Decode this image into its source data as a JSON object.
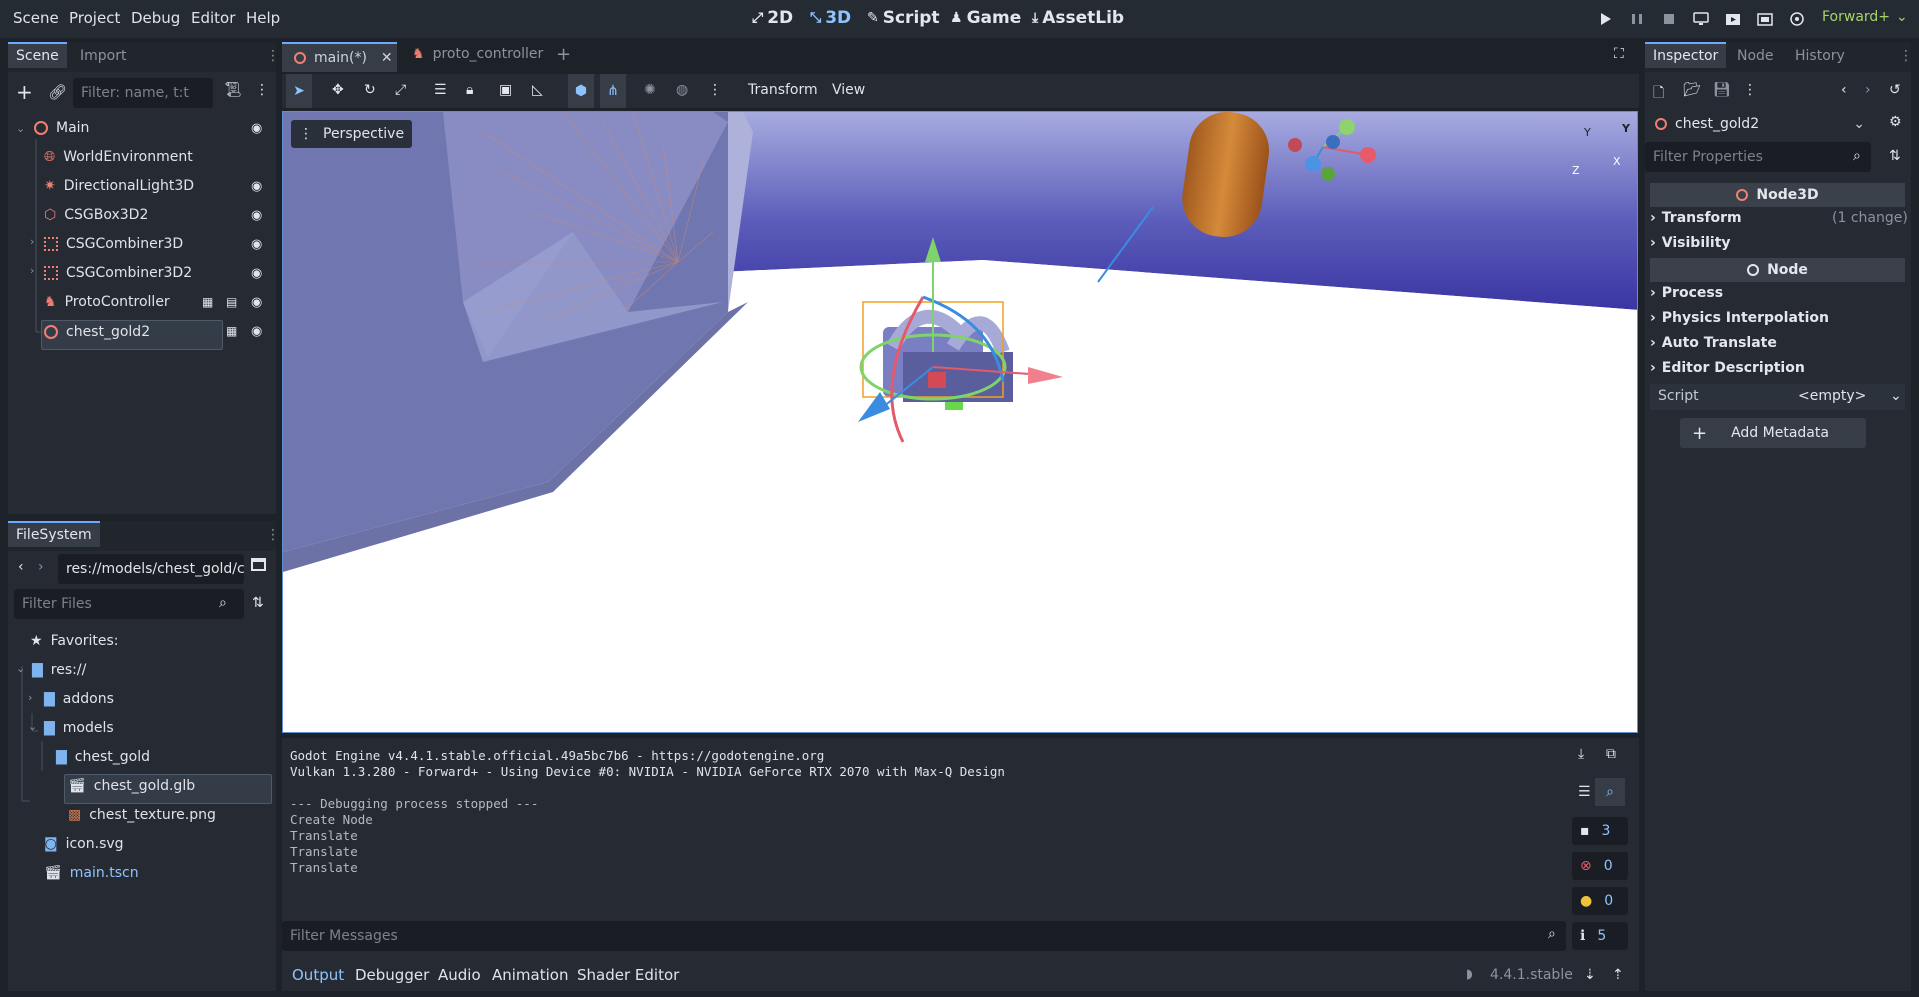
{
  "menu": [
    "Scene",
    "Project",
    "Debug",
    "Editor",
    "Help"
  ],
  "modes": [
    {
      "label": "2D",
      "icon": "2d-icon"
    },
    {
      "label": "3D",
      "icon": "3d-icon"
    },
    {
      "label": "Script",
      "icon": "script-icon"
    },
    {
      "label": "Game",
      "icon": "game-icon"
    },
    {
      "label": "AssetLib",
      "icon": "assetlib-icon"
    }
  ],
  "renderer": "Forward+",
  "scene_dock": {
    "tabs": [
      "Scene",
      "Import"
    ],
    "filter_placeholder": "Filter: name, t:t",
    "tree": [
      {
        "label": "Main",
        "icon": "node3d-icon"
      },
      {
        "label": "WorldEnvironment",
        "icon": "world-environment-icon"
      },
      {
        "label": "DirectionalLight3D",
        "icon": "light-icon"
      },
      {
        "label": "CSGBox3D2",
        "icon": "csg-box-icon"
      },
      {
        "label": "CSGCombiner3D",
        "icon": "csg-combiner-icon"
      },
      {
        "label": "CSGCombiner3D2",
        "icon": "csg-combiner-icon"
      },
      {
        "label": "ProtoController",
        "icon": "character-icon"
      },
      {
        "label": "chest_gold2",
        "icon": "node3d-icon"
      }
    ]
  },
  "filesystem": {
    "tab": "FileSystem",
    "path": "res://models/chest_gold/c",
    "filter_placeholder": "Filter Files",
    "items": [
      {
        "label": "Favorites:"
      },
      {
        "label": "res://"
      },
      {
        "label": "addons"
      },
      {
        "label": "models"
      },
      {
        "label": "chest_gold"
      },
      {
        "label": "chest_gold.glb"
      },
      {
        "label": "chest_texture.png"
      },
      {
        "label": "icon.svg"
      },
      {
        "label": "main.tscn"
      }
    ]
  },
  "editor_tabs": [
    {
      "label": "main(*)",
      "active": true
    },
    {
      "label": "proto_controller",
      "active": false
    }
  ],
  "toolbar": {
    "transform_label": "Transform",
    "view_label": "View"
  },
  "viewport": {
    "perspective_label": "Perspective",
    "gizmo_axes": [
      "Y",
      "X",
      "Z"
    ]
  },
  "output": {
    "lines": [
      "Godot Engine v4.4.1.stable.official.49a5bc7b6 - https://godotengine.org",
      "Vulkan 1.3.280 - Forward+ - Using Device #0: NVIDIA - NVIDIA GeForce RTX 2070 with Max-Q Design",
      "",
      "--- Debugging process stopped ---",
      "Create Node",
      "Translate",
      "Translate",
      "Translate"
    ],
    "filter_placeholder": "Filter Messages",
    "counts": {
      "messages": "3",
      "errors": "0",
      "warnings": "0",
      "info": "5"
    }
  },
  "bottom_tabs": [
    "Output",
    "Debugger",
    "Audio",
    "Animation",
    "Shader Editor"
  ],
  "version": "4.4.1.stable",
  "inspector": {
    "tabs": [
      "Inspector",
      "Node",
      "History"
    ],
    "selected_node": "chest_gold2",
    "filter_placeholder": "Filter Properties",
    "node3d_header": "Node3D",
    "node_header": "Node",
    "node3d_sections": [
      "Transform",
      "Visibility"
    ],
    "transform_change": "(1 change)",
    "node_sections": [
      "Process",
      "Physics Interpolation",
      "Auto Translate",
      "Editor Description"
    ],
    "script_label": "Script",
    "script_value": "<empty>",
    "add_metadata": "Add Metadata"
  },
  "colors": {
    "accent": "#8fc3ff",
    "panel": "#262b33",
    "background": "#1d2229"
  }
}
